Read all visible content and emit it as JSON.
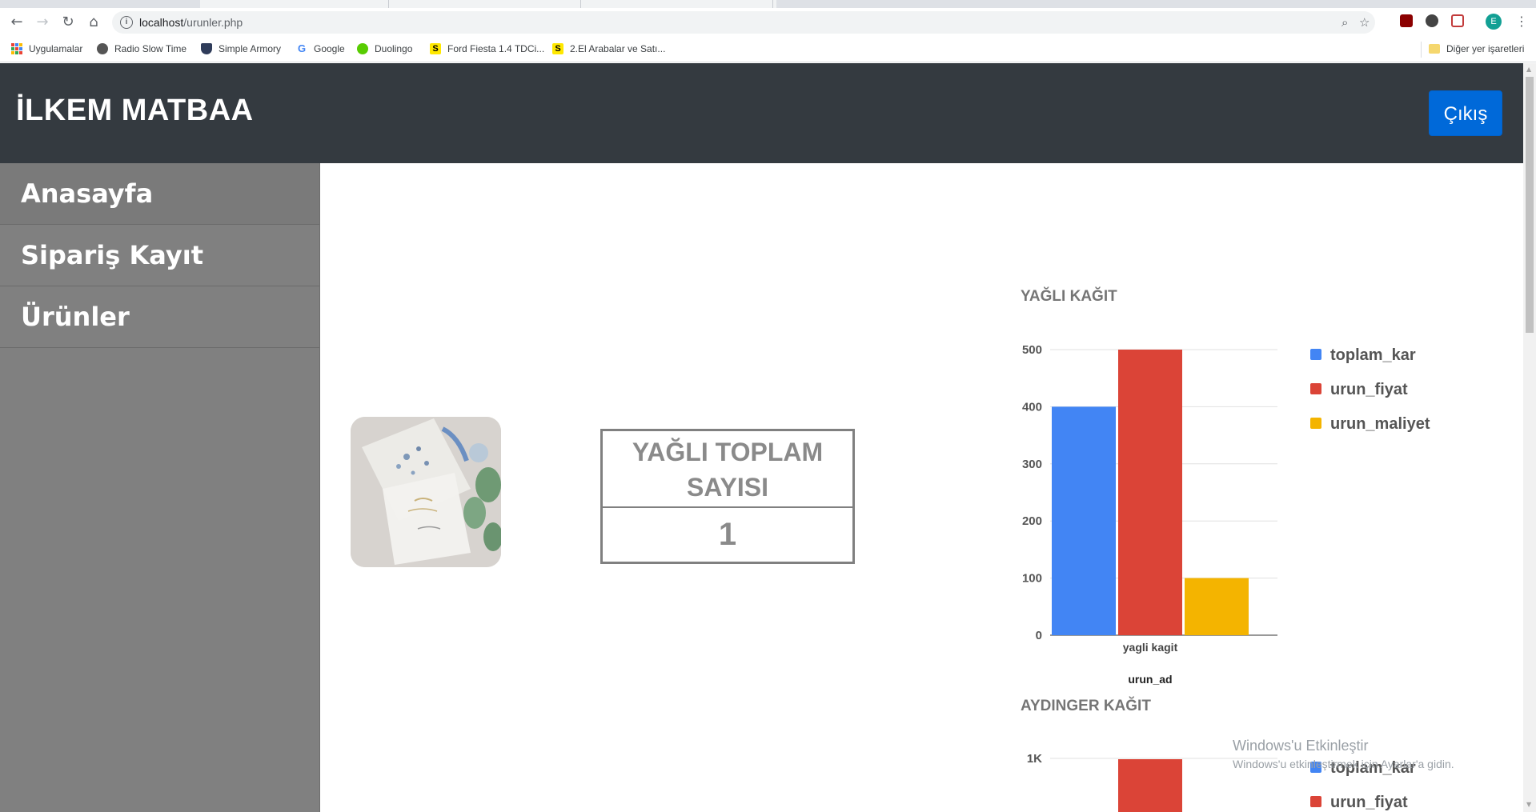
{
  "browser": {
    "url_host": "localhost",
    "url_path": "/urunler.php",
    "profile_initial": "E",
    "bookmarks": [
      {
        "label": "Uygulamalar",
        "icon": "apps-grid-icon"
      },
      {
        "label": "Radio Slow Time",
        "icon": "radio-icon"
      },
      {
        "label": "Simple Armory",
        "icon": "shield-icon"
      },
      {
        "label": "Google",
        "icon": "google-icon"
      },
      {
        "label": "Duolingo",
        "icon": "duolingo-icon"
      },
      {
        "label": "Ford Fiesta 1.4 TDCi...",
        "icon": "sahibinden-icon"
      },
      {
        "label": "2.El Arabalar ve Satı...",
        "icon": "sahibinden-icon"
      }
    ],
    "other_bookmarks": "Diğer yer işaretleri"
  },
  "header": {
    "brand": "İLKEM MATBAA",
    "logout_label": "Çıkış"
  },
  "sidebar": {
    "items": [
      {
        "label": "Anasayfa"
      },
      {
        "label": "Sipariş Kayıt"
      },
      {
        "label": "Ürünler"
      }
    ]
  },
  "stat": {
    "title": "YAĞLI TOPLAM SAYISI",
    "value": "1"
  },
  "colors": {
    "toplam_kar": "#4285f4",
    "urun_fiyat": "#db4437",
    "urun_maliyet": "#f4b400"
  },
  "chart_data": [
    {
      "type": "bar",
      "title": "YAĞLI KAĞIT",
      "categories": [
        "yagli kagit"
      ],
      "xlabel": "urun_ad",
      "ylabel": "",
      "ylim": [
        0,
        500
      ],
      "yticks": [
        "0",
        "100",
        "200",
        "300",
        "400",
        "500"
      ],
      "legend_position": "right",
      "series": [
        {
          "name": "toplam_kar",
          "values": [
            400
          ]
        },
        {
          "name": "urun_fiyat",
          "values": [
            500
          ]
        },
        {
          "name": "urun_maliyet",
          "values": [
            100
          ]
        }
      ]
    },
    {
      "type": "bar",
      "title": "AYDINGER KAĞIT",
      "categories": [
        ""
      ],
      "xlabel": "",
      "ylabel": "",
      "yticks_visible": [
        "1K"
      ],
      "legend_position": "right",
      "series": [
        {
          "name": "toplam_kar",
          "values": []
        },
        {
          "name": "urun_fiyat",
          "values": [
            1000
          ]
        }
      ]
    }
  ],
  "watermark": {
    "line1": "Windows'u Etkinleştir",
    "line2": "Windows'u etkinleştirmek için Ayarlar'a gidin."
  }
}
